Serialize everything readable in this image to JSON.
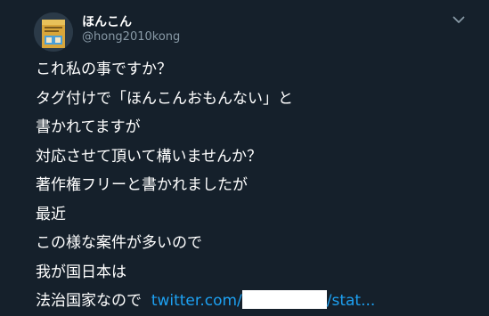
{
  "tweet": {
    "author_name": "ほんこん",
    "author_handle": "@hong2010kong",
    "lines": [
      "これ私の事ですか？",
      "タグ付けで「ほんこんおもんない」と",
      "書かれてますが",
      "対応させて頂いて構いませんか？",
      "著作権フリーと書かれましたが",
      "最近",
      "この様な案件が多いので",
      "我が国日本は",
      "法治国家なので"
    ],
    "link_prefix": "twitter.com/",
    "link_suffix": "/stat..."
  },
  "colors": {
    "background": "#15202b",
    "text": "#ffffff",
    "handle": "#8899a6",
    "link": "#1da1f2",
    "redaction": "#ffffff"
  },
  "icons": {
    "menu": "chevron-down-icon",
    "avatar": "profile-avatar"
  }
}
